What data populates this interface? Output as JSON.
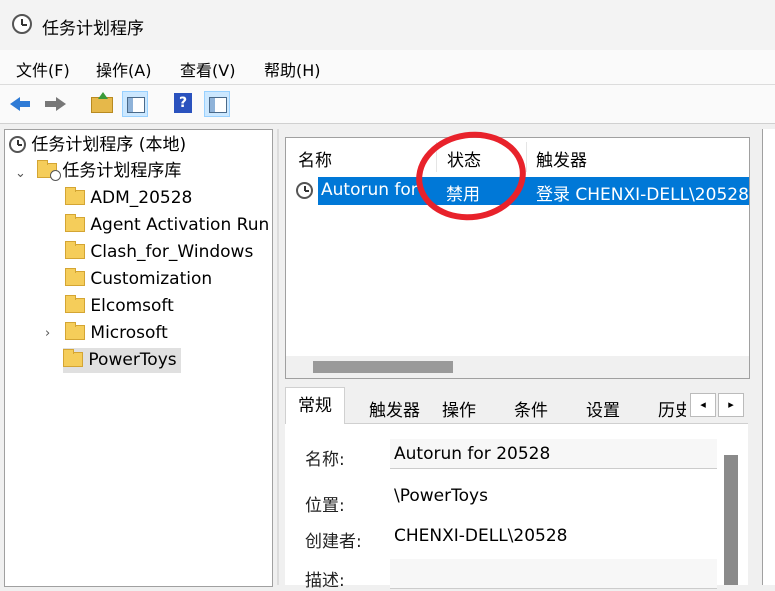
{
  "window": {
    "title": "任务计划程序"
  },
  "menu": [
    "文件(F)",
    "操作(A)",
    "查看(V)",
    "帮助(H)"
  ],
  "toolbar": {
    "buttons": [
      "back-icon",
      "forward-icon",
      "up-folder-icon",
      "show-hide-console-tree-icon",
      "help-icon",
      "show-hide-action-pane-icon"
    ]
  },
  "tree": {
    "root": "任务计划程序 (本地)",
    "library": "任务计划程序库",
    "folders": [
      "ADM_20528",
      "Agent Activation Run",
      "Clash_for_Windows",
      "Customization",
      "Elcomsoft",
      "Microsoft",
      "PowerToys"
    ],
    "selected": "PowerToys"
  },
  "task_list": {
    "columns": [
      "名称",
      "状态",
      "触发器"
    ],
    "rows": [
      {
        "name": "Autorun for",
        "status": "禁用",
        "trigger": "登录 CHENXI-DELL\\20528"
      }
    ]
  },
  "annotation": {
    "color": "#e8222b"
  },
  "properties": {
    "tabs": [
      "常规",
      "触发器",
      "操作",
      "条件",
      "设置",
      "历史"
    ],
    "active_tab": "常规",
    "fields": [
      {
        "label": "名称:",
        "value": "Autorun for 20528"
      },
      {
        "label": "位置:",
        "value": "\\PowerToys"
      },
      {
        "label": "创建者:",
        "value": "CHENXI-DELL\\20528"
      },
      {
        "label": "描述:",
        "value": ""
      }
    ]
  },
  "colors": {
    "selection": "#0078d7",
    "accent": "#cce8ff"
  }
}
